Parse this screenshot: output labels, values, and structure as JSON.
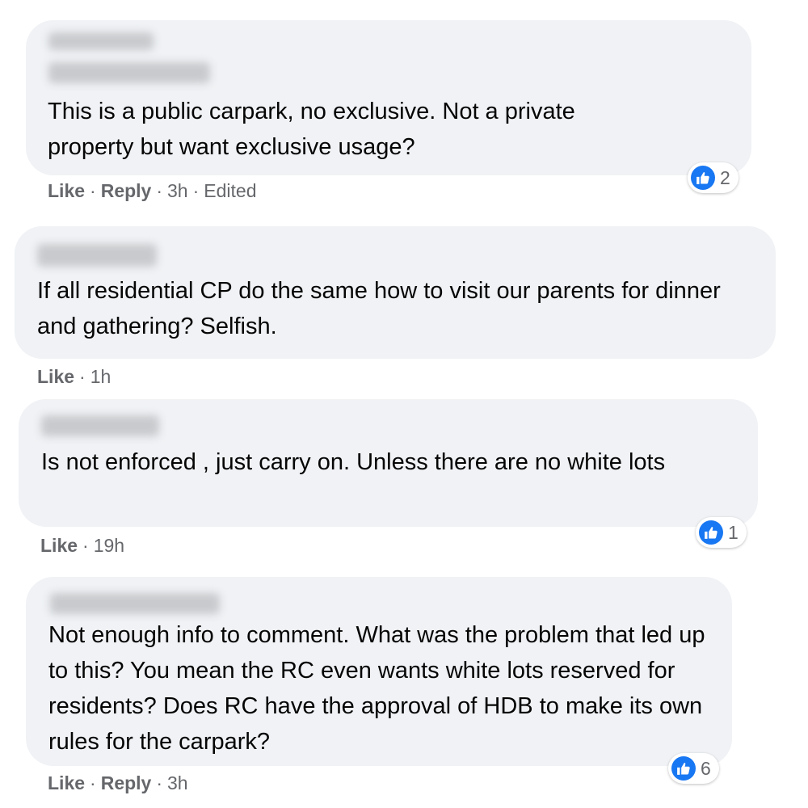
{
  "comments": [
    {
      "text": "This is a public carpark, no exclusive. Not a private property but want exclusive usage?",
      "actions": {
        "like": "Like",
        "reply": "Reply"
      },
      "time": "3h",
      "edited": "Edited",
      "reaction": {
        "icon": "thumbs-up-icon",
        "count": "2"
      }
    },
    {
      "text": "If all residential CP do the same how to visit our parents for dinner and gathering? Selfish.",
      "actions": {
        "like": "Like"
      },
      "time": "1h"
    },
    {
      "text": "Is not enforced , just carry on. Unless there are no white lots",
      "actions": {
        "like": "Like"
      },
      "time": "19h",
      "reaction": {
        "icon": "thumbs-up-icon",
        "count": "1"
      }
    },
    {
      "text": "Not enough info to comment. What was the problem that led up to this? You mean the RC even wants white lots reserved for residents? Does RC have the approval of HDB to make its own rules for the carpark?",
      "actions": {
        "like": "Like",
        "reply": "Reply"
      },
      "time": "3h",
      "reaction": {
        "icon": "thumbs-up-icon",
        "count": "6"
      }
    }
  ],
  "colors": {
    "bubble": "#f0f2f5",
    "accent": "#1877f2",
    "meta": "#65676b"
  }
}
